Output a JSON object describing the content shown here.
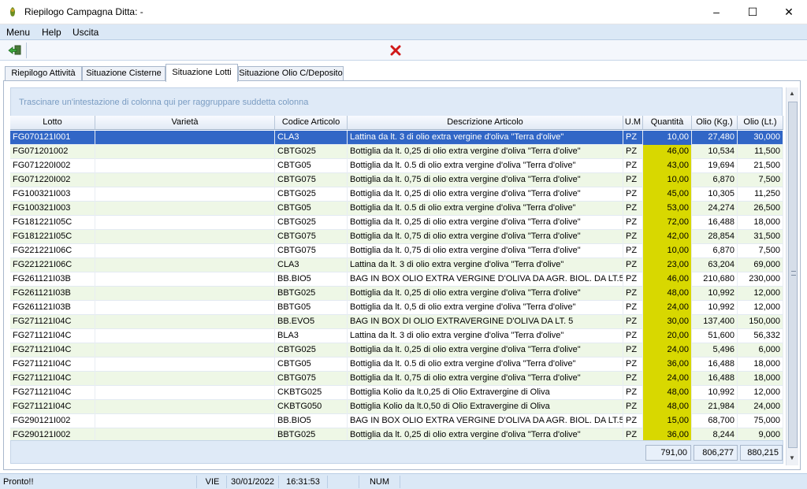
{
  "window": {
    "title": "Riepilogo Campagna Ditta: -"
  },
  "menu": {
    "items": [
      "Menu",
      "Help",
      "Uscita"
    ]
  },
  "tabs": [
    "Riepilogo Attività",
    "Situazione Cisterne",
    "Situazione Lotti",
    "Situazione Olio C/Deposito"
  ],
  "group_hint": "Trascinare un'intestazione di colonna qui per raggruppare suddetta colonna",
  "columns": [
    "Lotto",
    "Varietà",
    "Codice Articolo",
    "Descrizione Articolo",
    "U.M",
    "Quantità",
    "Olio (Kg.)",
    "Olio (Lt.)"
  ],
  "rows": [
    [
      "FG070121I001",
      "",
      "CLA3",
      "Lattina da lt.  3  di olio extra vergine d'oliva \"Terra d'olive\"",
      "PZ",
      "10,00",
      "27,480",
      "30,000"
    ],
    [
      "FG071201002",
      "",
      "CBTG025",
      "Bottiglia da lt. 0,25 di olio extra vergine d'oliva \"Terra d'olive\"",
      "PZ",
      "46,00",
      "10,534",
      "11,500"
    ],
    [
      "FG071220I002",
      "",
      "CBTG05",
      "Bottiglia da lt. 0.5   di olio extra vergine d'oliva \"Terra d'olive\"",
      "PZ",
      "43,00",
      "19,694",
      "21,500"
    ],
    [
      "FG071220I002",
      "",
      "CBTG075",
      "Bottiglia da lt. 0,75 di olio extra vergine d'oliva \"Terra d'olive\"",
      "PZ",
      "10,00",
      "6,870",
      "7,500"
    ],
    [
      "FG100321I003",
      "",
      "CBTG025",
      "Bottiglia da lt. 0,25 di olio extra vergine d'oliva \"Terra d'olive\"",
      "PZ",
      "45,00",
      "10,305",
      "11,250"
    ],
    [
      "FG100321I003",
      "",
      "CBTG05",
      "Bottiglia da lt. 0.5   di olio extra vergine d'oliva \"Terra d'olive\"",
      "PZ",
      "53,00",
      "24,274",
      "26,500"
    ],
    [
      "FG181221I05C",
      "",
      "CBTG025",
      "Bottiglia da lt. 0,25 di olio extra vergine d'oliva \"Terra d'olive\"",
      "PZ",
      "72,00",
      "16,488",
      "18,000"
    ],
    [
      "FG181221I05C",
      "",
      "CBTG075",
      "Bottiglia da lt. 0,75 di olio extra vergine d'oliva \"Terra d'olive\"",
      "PZ",
      "42,00",
      "28,854",
      "31,500"
    ],
    [
      "FG221221I06C",
      "",
      "CBTG075",
      "Bottiglia da lt. 0,75 di olio extra vergine d'oliva \"Terra d'olive\"",
      "PZ",
      "10,00",
      "6,870",
      "7,500"
    ],
    [
      "FG221221I06C",
      "",
      "CLA3",
      "Lattina da lt.  3  di olio extra vergine d'oliva \"Terra d'olive\"",
      "PZ",
      "23,00",
      "63,204",
      "69,000"
    ],
    [
      "FG261121I03B",
      "",
      "BB.BIO5",
      "BAG IN BOX OLIO EXTRA VERGINE D'OLIVA DA AGR. BIOL. DA LT.5",
      "PZ",
      "46,00",
      "210,680",
      "230,000"
    ],
    [
      "FG261121I03B",
      "",
      "BBTG025",
      "Bottiglia da lt. 0,25 di olio extra vergine d'oliva \"Terra d'olive\"",
      "PZ",
      "48,00",
      "10,992",
      "12,000"
    ],
    [
      "FG261121I03B",
      "",
      "BBTG05",
      "Bottiglia da lt. 0,5   di olio extra vergine d'oliva \"Terra d'olive\"",
      "PZ",
      "24,00",
      "10,992",
      "12,000"
    ],
    [
      "FG271121I04C",
      "",
      "BB.EVO5",
      "BAG IN BOX  DI OLIO EXTRAVERGINE D'OLIVA DA LT. 5",
      "PZ",
      "30,00",
      "137,400",
      "150,000"
    ],
    [
      "FG271121I04C",
      "",
      "BLA3",
      "Lattina da lt. 3   di olio extra vergine d'oliva \"Terra d'olive\"",
      "PZ",
      "20,00",
      "51,600",
      "56,332"
    ],
    [
      "FG271121I04C",
      "",
      "CBTG025",
      "Bottiglia da lt. 0,25 di olio extra vergine d'oliva \"Terra d'olive\"",
      "PZ",
      "24,00",
      "5,496",
      "6,000"
    ],
    [
      "FG271121I04C",
      "",
      "CBTG05",
      "Bottiglia da lt. 0.5   di olio extra vergine d'oliva \"Terra d'olive\"",
      "PZ",
      "36,00",
      "16,488",
      "18,000"
    ],
    [
      "FG271121I04C",
      "",
      "CBTG075",
      "Bottiglia da lt. 0,75 di olio extra vergine d'oliva \"Terra d'olive\"",
      "PZ",
      "24,00",
      "16,488",
      "18,000"
    ],
    [
      "FG271121I04C",
      "",
      "CKBTG025",
      "Bottiglia Kolio da lt.0,25 di Olio Extravergine di Oliva",
      "PZ",
      "48,00",
      "10,992",
      "12,000"
    ],
    [
      "FG271121I04C",
      "",
      "CKBTG050",
      "Bottiglia Kolio da lt.0,50 di Olio Extravergine di Oliva",
      "PZ",
      "48,00",
      "21,984",
      "24,000"
    ],
    [
      "FG290121I002",
      "",
      "BB.BIO5",
      "BAG IN BOX OLIO EXTRA VERGINE D'OLIVA DA AGR. BIOL. DA LT.5",
      "PZ",
      "15,00",
      "68,700",
      "75,000"
    ],
    [
      "FG290121I002",
      "",
      "BBTG025",
      "Bottiglia da lt. 0,25 di olio extra vergine d'oliva \"Terra d'olive\"",
      "PZ",
      "36,00",
      "8,244",
      "9,000"
    ]
  ],
  "totals": {
    "quantita": "791,00",
    "olio_kg": "806,277",
    "olio_lt": "880,215"
  },
  "status": {
    "message": "Pronto!!",
    "day": "VIE",
    "date": "30/01/2022",
    "time": "16:31:53",
    "num": "NUM"
  },
  "colors": {
    "selection": "#3166c6",
    "alt_row": "#eef7e6",
    "quantity_fill": "#d8d800",
    "menubar": "#dbe8f6"
  }
}
